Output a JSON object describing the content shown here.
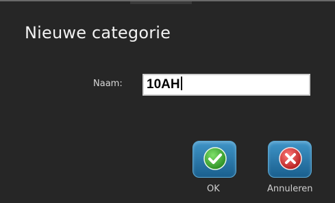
{
  "dialog": {
    "title": "Nieuwe categorie",
    "name_label": "Naam:",
    "name_value": "10AH"
  },
  "buttons": {
    "ok_label": "OK",
    "cancel_label": "Annuleren"
  },
  "icons": {
    "ok": "checkmark-icon",
    "cancel": "x-close-icon"
  },
  "colors": {
    "background": "#262626",
    "button_blue": "#2a7bb0",
    "ok_green": "#3aa832",
    "cancel_red": "#d23a3a"
  }
}
